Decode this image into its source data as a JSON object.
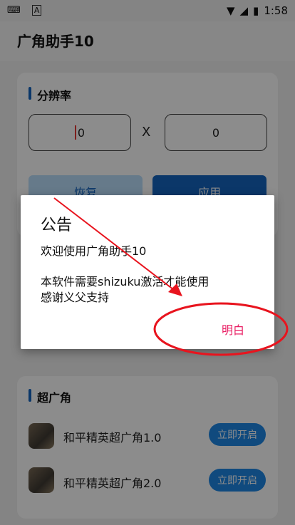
{
  "status": {
    "time": "1:58"
  },
  "app": {
    "title": "广角助手10"
  },
  "resolution": {
    "section_title": "分辨率",
    "width_value": "0",
    "height_value": "0",
    "separator": "X",
    "restore_label": "恢复",
    "apply_label": "应用"
  },
  "wide": {
    "section_title": "超广角",
    "items": [
      {
        "name": "和平精英超广角1.0",
        "button": "立即开启"
      },
      {
        "name": "和平精英超广角2.0",
        "button": "立即开启"
      }
    ]
  },
  "dialog": {
    "title": "公告",
    "line1": "欢迎使用广角助手10",
    "line2": "本软件需要shizuku激活才能使用",
    "line3": "感谢义父支持",
    "ok_label": "明白"
  },
  "colors": {
    "accent": "#1565c0",
    "dialog_button": "#e91e63",
    "annotation": "#e8141e"
  }
}
